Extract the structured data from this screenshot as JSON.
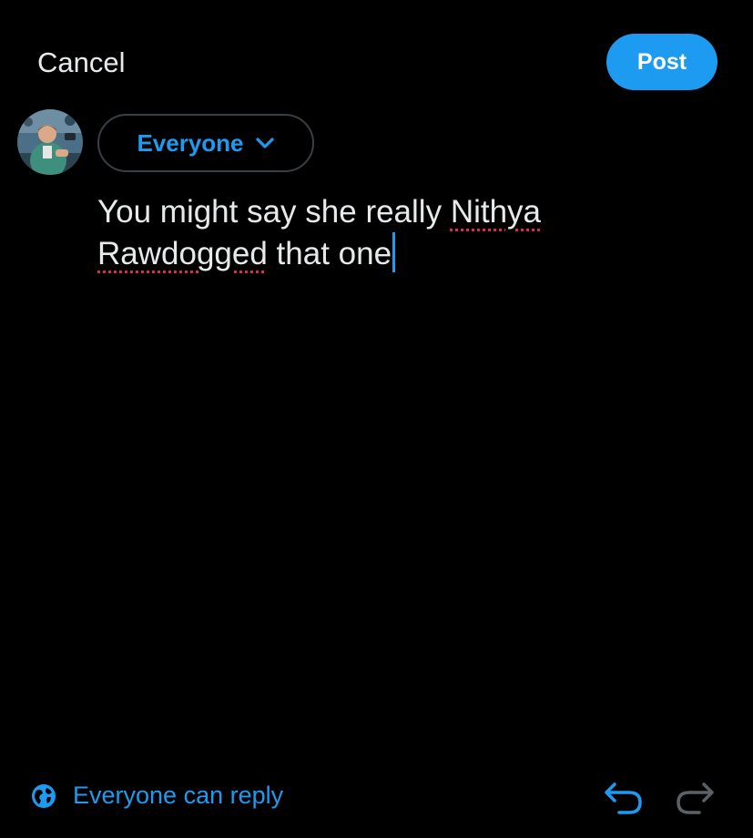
{
  "header": {
    "cancel_label": "Cancel",
    "post_label": "Post"
  },
  "composer": {
    "avatar_icon": "user-avatar-photo",
    "audience_label": "Everyone",
    "audience_icon": "chevron-down-icon",
    "text_lines": [
      {
        "before": "You might say she really ",
        "misspelled": "Nithya",
        "after": ""
      },
      {
        "before": "",
        "misspelled": "Rawdogged",
        "after": " that one"
      }
    ]
  },
  "footer": {
    "reply_setting_icon": "globe-icon",
    "reply_setting_label": "Everyone can reply",
    "undo_icon": "undo-icon",
    "redo_icon": "redo-icon"
  },
  "colors": {
    "background": "#000000",
    "accent": "#1d9bf0",
    "text": "#e7e9ea",
    "spellcheck": "#e0245e",
    "disabled": "#5b6166"
  }
}
